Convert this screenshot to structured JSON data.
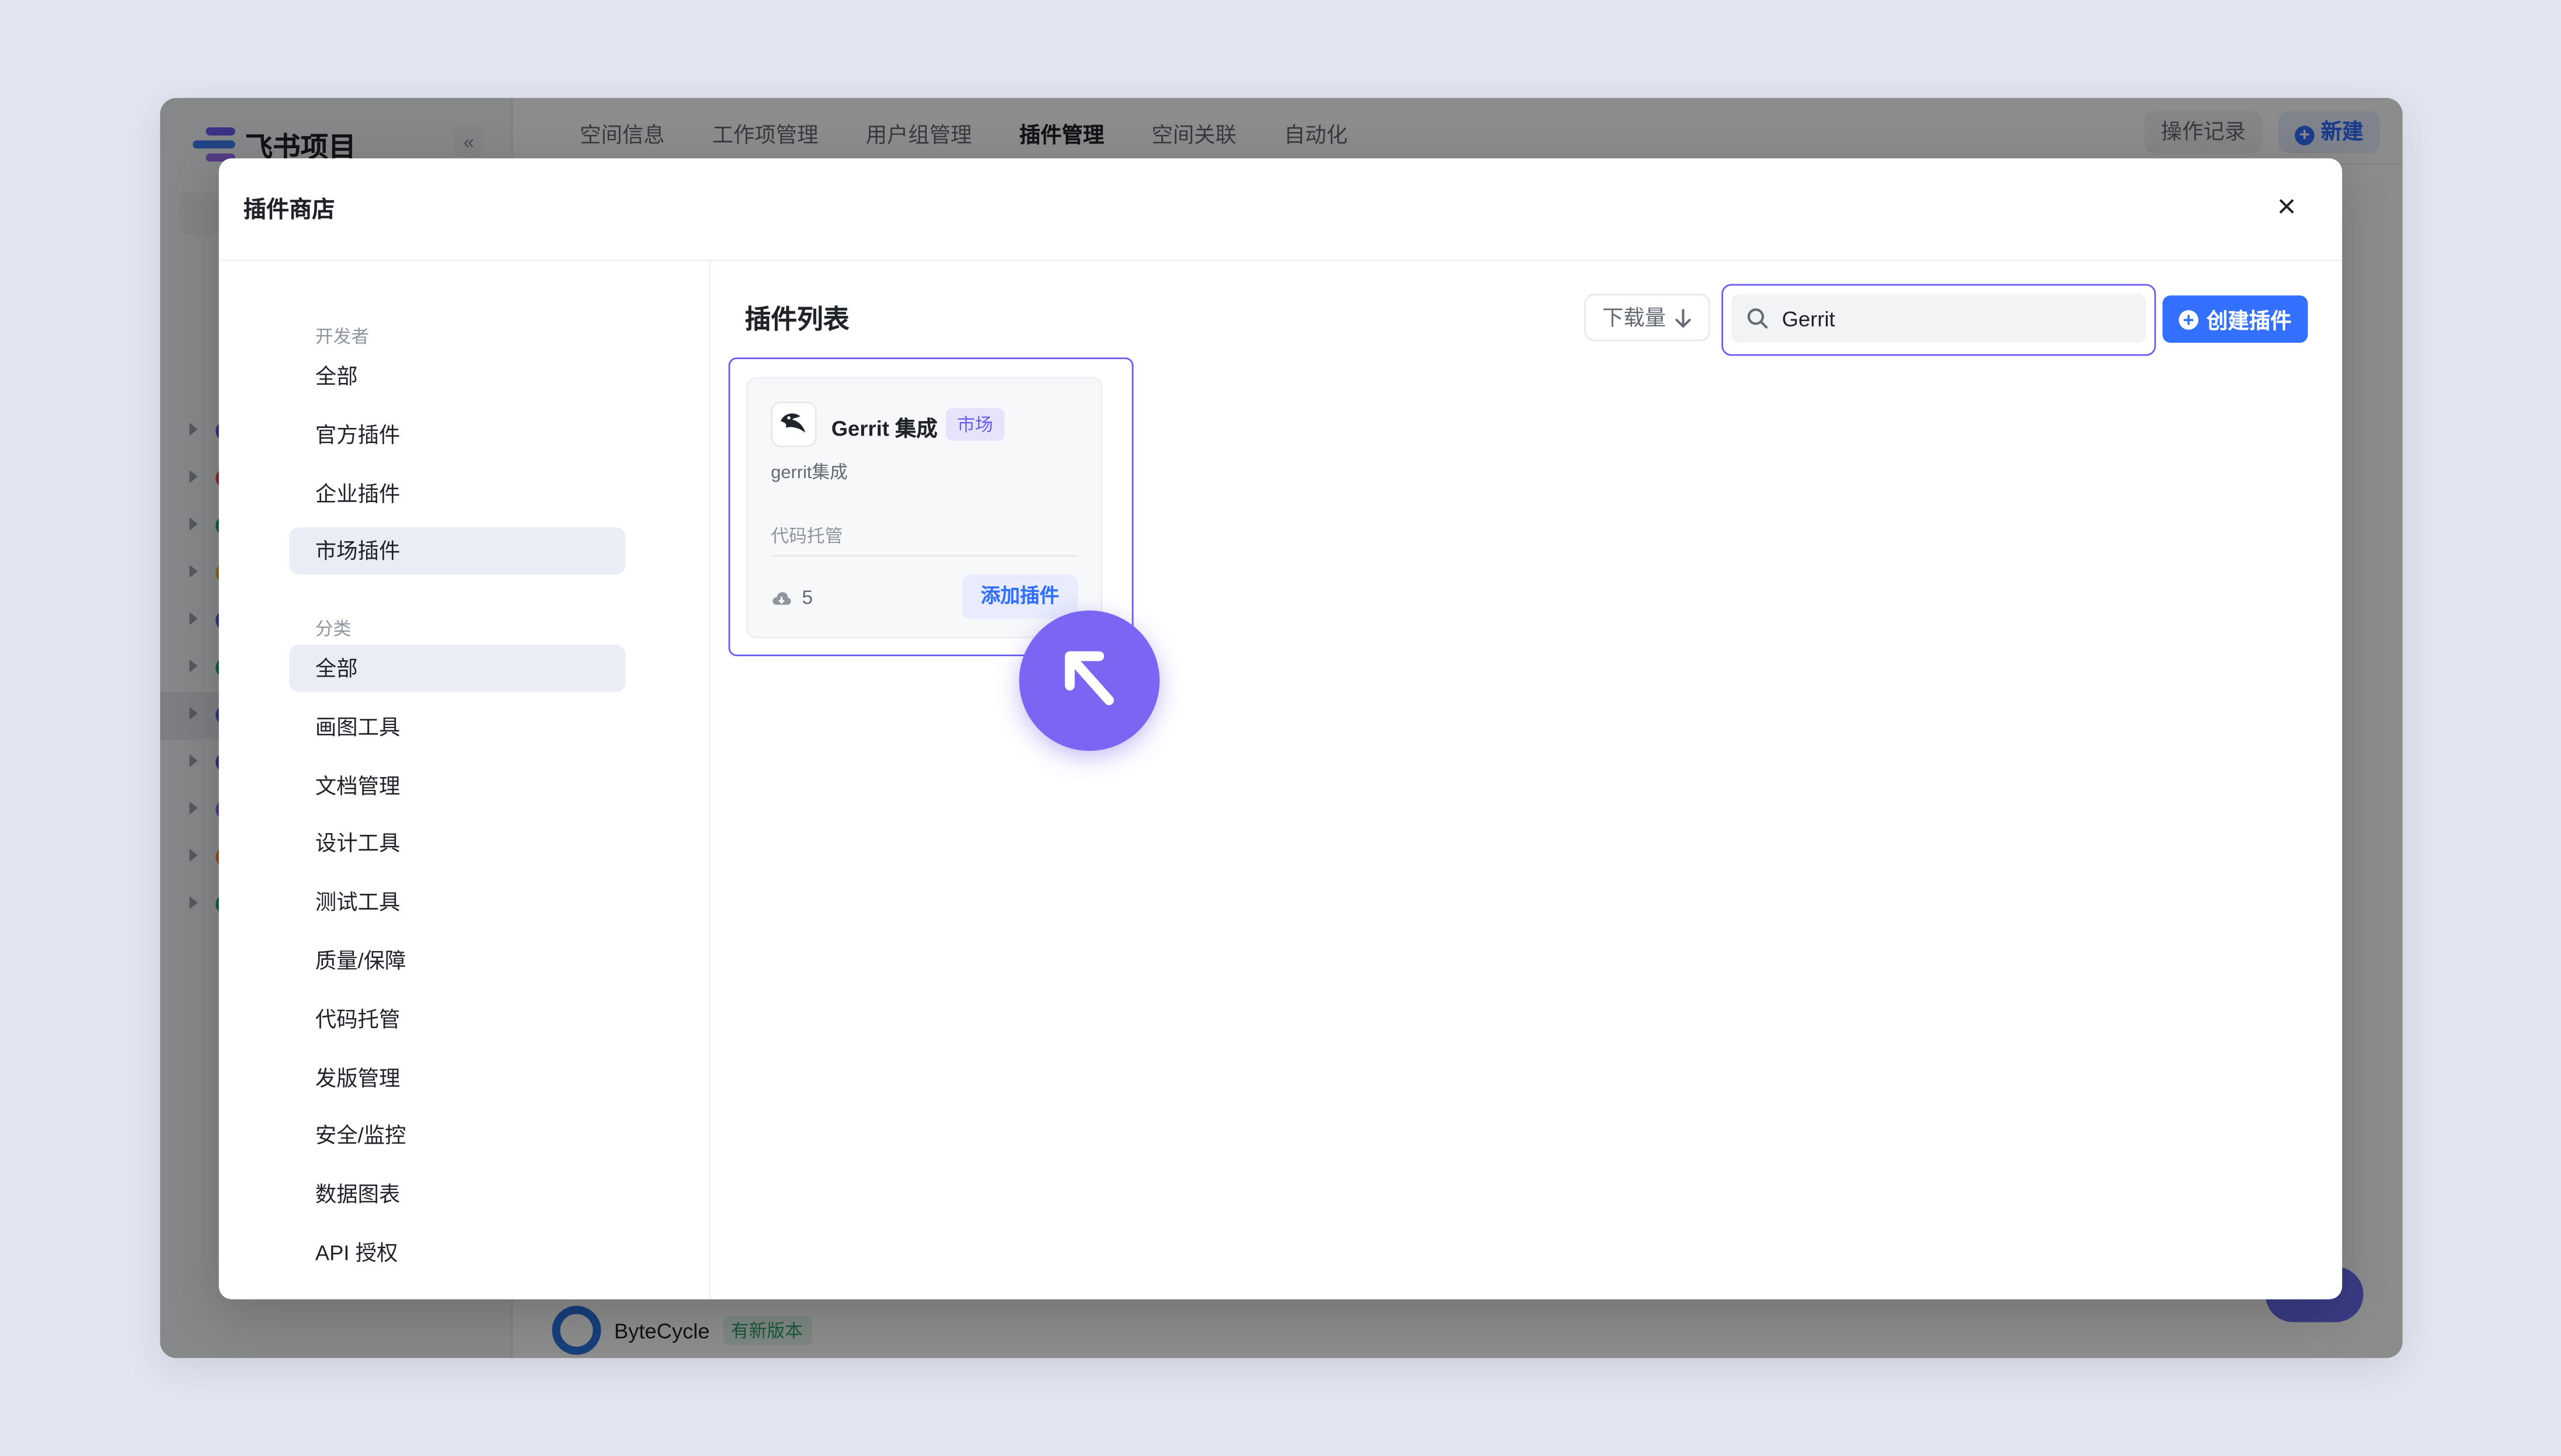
{
  "app": {
    "logo_text": "飞书项目",
    "collapse_icon": "«",
    "nav_tabs": [
      "空间信息",
      "工作项管理",
      "用户组管理",
      "插件管理",
      "空间关联",
      "自动化"
    ],
    "active_tab": "插件管理",
    "operation_log": "操作记录",
    "new_button": "新建",
    "bg_row": {
      "name": "ByteCycle",
      "badge": "有新版本"
    },
    "sidebar_dot_colors": [
      "#5b5bd6",
      "#e5484d",
      "#2f9e6d",
      "#f2b233",
      "#5b5bd6",
      "#2f9e6d",
      "#5b5bd6",
      "#5b5bd6",
      "#9a6cf5",
      "#f5893a",
      "#2f9e6d"
    ]
  },
  "modal": {
    "title": "插件商店",
    "close_icon": "×"
  },
  "filters": {
    "developer_label": "开发者",
    "developer_items": [
      "全部",
      "官方插件",
      "企业插件",
      "市场插件"
    ],
    "developer_selected": "市场插件",
    "category_label": "分类",
    "category_items": [
      "全部",
      "画图工具",
      "文档管理",
      "设计工具",
      "测试工具",
      "质量/保障",
      "代码托管",
      "发版管理",
      "安全/监控",
      "数据图表",
      "API 授权"
    ],
    "category_selected": "全部"
  },
  "main": {
    "list_title": "插件列表",
    "sort_label": "下载量",
    "search_value": "Gerrit",
    "create_button": "创建插件"
  },
  "plugin_card": {
    "name": "Gerrit 集成",
    "badge": "市场",
    "description": "gerrit集成",
    "category": "代码托管",
    "downloads": "5",
    "add_button": "添加插件"
  },
  "colors": {
    "accent": "#3370ff",
    "highlight": "#6a5cf0",
    "cursor": "#7a66f2"
  }
}
